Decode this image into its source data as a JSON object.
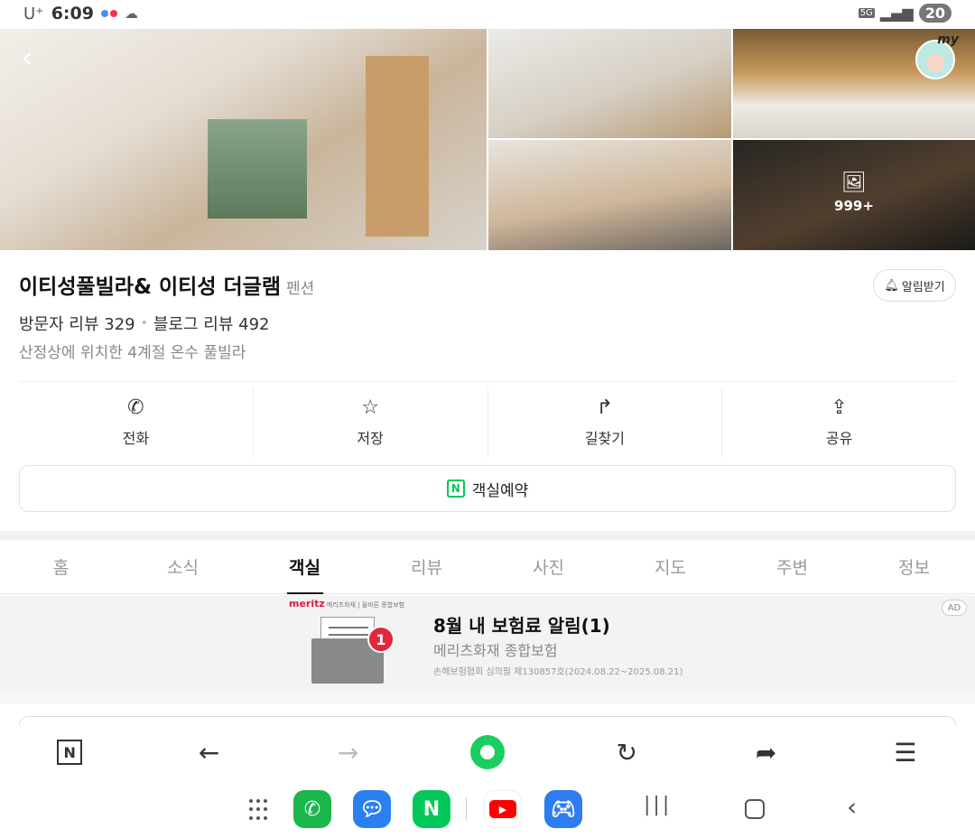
{
  "status_bar": {
    "carrier": "U⁺",
    "time": "6:09",
    "network": "5G",
    "battery": "20",
    "dot_colors": [
      "#4a8cf7",
      "#f0315e"
    ]
  },
  "gallery": {
    "photo_count": "999+"
  },
  "my_badge": "my",
  "place": {
    "name": "이티성풀빌라& 이티성 더글램",
    "category": "펜션",
    "alarm_label": "알림받기",
    "visitor_reviews": "방문자 리뷰 329",
    "blog_reviews": "블로그 리뷰 492",
    "description": "산정상에 위치한 4계절 온수 풀빌라"
  },
  "actions": [
    {
      "label": "전화",
      "icon": "phone-icon"
    },
    {
      "label": "저장",
      "icon": "star-icon"
    },
    {
      "label": "길찾기",
      "icon": "directions-icon"
    },
    {
      "label": "공유",
      "icon": "share-icon"
    }
  ],
  "reserve": {
    "label": "객실예약",
    "icon_letter": "N"
  },
  "tabs": [
    "홈",
    "소식",
    "객실",
    "리뷰",
    "사진",
    "지도",
    "주변",
    "정보"
  ],
  "active_tab": "객실",
  "ad": {
    "brand": "meritz",
    "brand_sub": "메리츠화재 | 올바른 종합보험",
    "badge_number": "1",
    "title": "8월 내 보험료 알림(1)",
    "subtitle": "메리츠화재 종합보험",
    "fine_print": "손해보험협회 심의필 제130857호(2024.08.22~2025.08.21)",
    "ad_label": "AD"
  },
  "browser_toolbar": {
    "naver_letter": "N"
  },
  "nav_apps": [
    "phone-app-icon",
    "talk-app-icon",
    "naver-app-icon",
    "youtube-app-icon",
    "game-app-icon"
  ],
  "naver_app_letter": "N"
}
